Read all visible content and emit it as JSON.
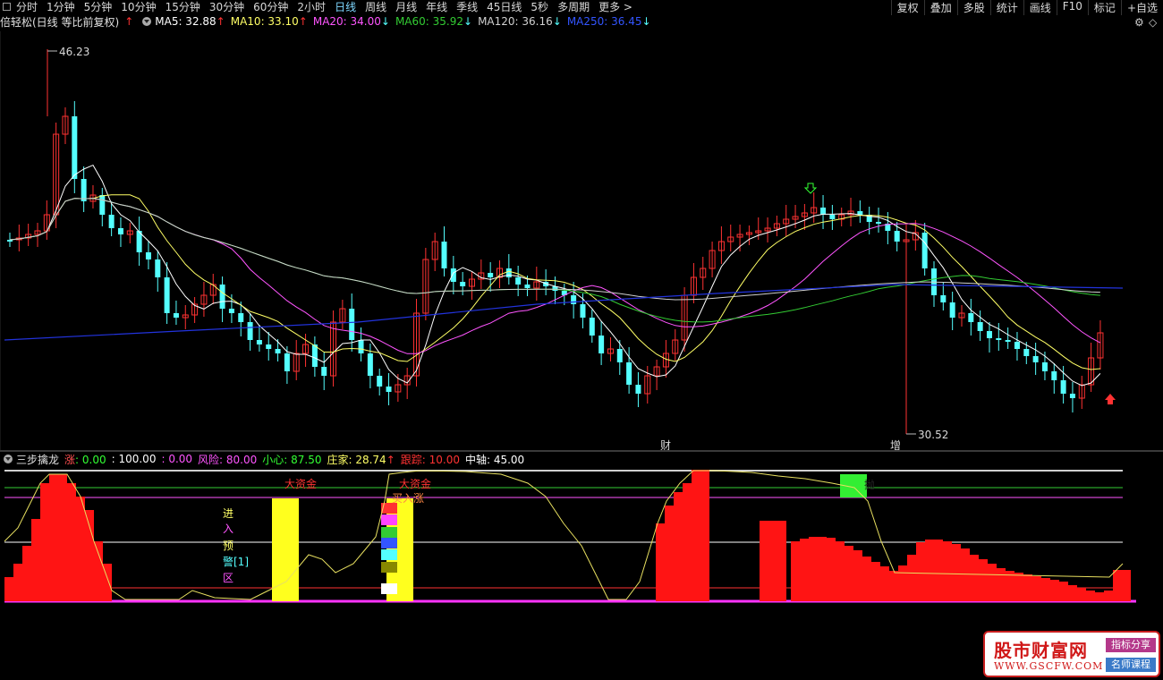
{
  "toolbar": {
    "timeframes": [
      "分时",
      "1分钟",
      "5分钟",
      "10分钟",
      "15分钟",
      "30分钟",
      "60分钟",
      "2小时",
      "日线",
      "周线",
      "月线",
      "年线",
      "季线",
      "45日线",
      "5秒",
      "多周期",
      "更多 >"
    ],
    "active": "日线",
    "right_buttons": [
      "复权",
      "叠加",
      "多股",
      "统计",
      "画线",
      "F10",
      "标记",
      "+自选"
    ]
  },
  "main_legend": {
    "title": "倍轻松(日线 等比前复权)",
    "items": [
      {
        "text": "MA5: 32.88",
        "arrow": "↑",
        "color": "#ffffff"
      },
      {
        "text": "MA10: 33.10",
        "arrow": "↑",
        "color": "#ffff66"
      },
      {
        "text": "MA20: 34.00",
        "arrow": "↓",
        "color": "#ff55ff"
      },
      {
        "text": "MA60: 35.92",
        "arrow": "↓",
        "color": "#33cc33"
      },
      {
        "text": "MA120: 36.16",
        "arrow": "↓",
        "color": "#d0d0d0"
      },
      {
        "text": "MA250: 36.45",
        "arrow": "↓",
        "color": "#3355ff"
      }
    ]
  },
  "annotations": {
    "high": "46.23",
    "low": "30.52",
    "cai": "财",
    "zeng": "增"
  },
  "indicator_legend": {
    "name": "三步擒龙",
    "zhang_label": "涨",
    "zhang_value": ": 0.00",
    "v100": ": 100.00",
    "v0": ": 0.00",
    "risk": "风险: 80.00",
    "xiaoxin": "小心: 87.50",
    "zhuangjia": "庄家: 28.74",
    "zhuangjia_arrow": "↑",
    "genzong": "跟踪: 10.00",
    "zhongzhou": "中轴: 45.00"
  },
  "indicator_labels": {
    "dazijin1": "大资金",
    "dazijin2": "大资金",
    "mairu": "买入涨",
    "zone": [
      "进",
      "入",
      "预",
      "警[1]",
      "区"
    ],
    "green_text": "抛"
  },
  "colors": {
    "up": "#ff3232",
    "down": "#54ffff",
    "bg": "#000000"
  },
  "watermark": {
    "title": "股市财富网",
    "url": "WWW.GSCFW.COM",
    "badge1": "指标分享",
    "badge2": "名师课程"
  }
}
